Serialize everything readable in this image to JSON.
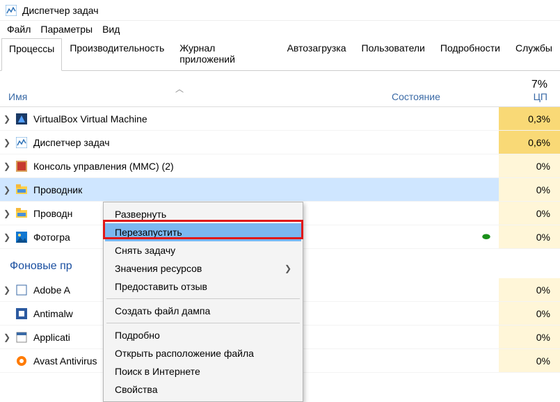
{
  "window": {
    "title": "Диспетчер задач"
  },
  "menu": {
    "file": "Файл",
    "options": "Параметры",
    "view": "Вид"
  },
  "tabs": [
    "Процессы",
    "Производительность",
    "Журнал приложений",
    "Автозагрузка",
    "Пользователи",
    "Подробности",
    "Службы"
  ],
  "active_tab": 0,
  "columns": {
    "name": "Имя",
    "state": "Состояние",
    "cpu_label": "ЦП",
    "cpu_total": "7%"
  },
  "rows": [
    {
      "exp": true,
      "icon": "virtualbox",
      "name": "VirtualBox Virtual Machine",
      "cpu": "0,3%",
      "hi": true
    },
    {
      "exp": true,
      "icon": "taskmgr",
      "name": "Диспетчер задач",
      "cpu": "0,6%",
      "hi": true
    },
    {
      "exp": true,
      "icon": "mmc",
      "name": "Консоль управления (MMC) (2)",
      "cpu": "0%"
    },
    {
      "exp": true,
      "icon": "explorer",
      "name": "Проводник",
      "cpu": "0%",
      "selected": true
    },
    {
      "exp": true,
      "icon": "explorer",
      "name": "Проводн",
      "cpu": "0%"
    },
    {
      "exp": true,
      "icon": "photos",
      "name": "Фотогра",
      "cpu": "0%",
      "leaf": true
    }
  ],
  "group_title": "Фоновые пр",
  "bg_rows": [
    {
      "exp": true,
      "icon": "adobe",
      "name": "Adobe A",
      "cpu": "0%"
    },
    {
      "exp": false,
      "icon": "shield",
      "name": "Antimalw",
      "cpu": "0%"
    },
    {
      "exp": true,
      "icon": "appfh",
      "name": "Applicati",
      "cpu": "0%"
    },
    {
      "exp": false,
      "icon": "avast",
      "name": "Avast Antivirus",
      "cpu": "0%"
    }
  ],
  "context_menu": {
    "expand": "Развернуть",
    "restart": "Перезапустить",
    "end_task": "Снять задачу",
    "resource_values": "Значения ресурсов",
    "feedback": "Предоставить отзыв",
    "create_dump": "Создать файл дампа",
    "details": "Подробно",
    "open_location": "Открыть расположение файла",
    "search_online": "Поиск в Интернете",
    "properties": "Свойства"
  }
}
